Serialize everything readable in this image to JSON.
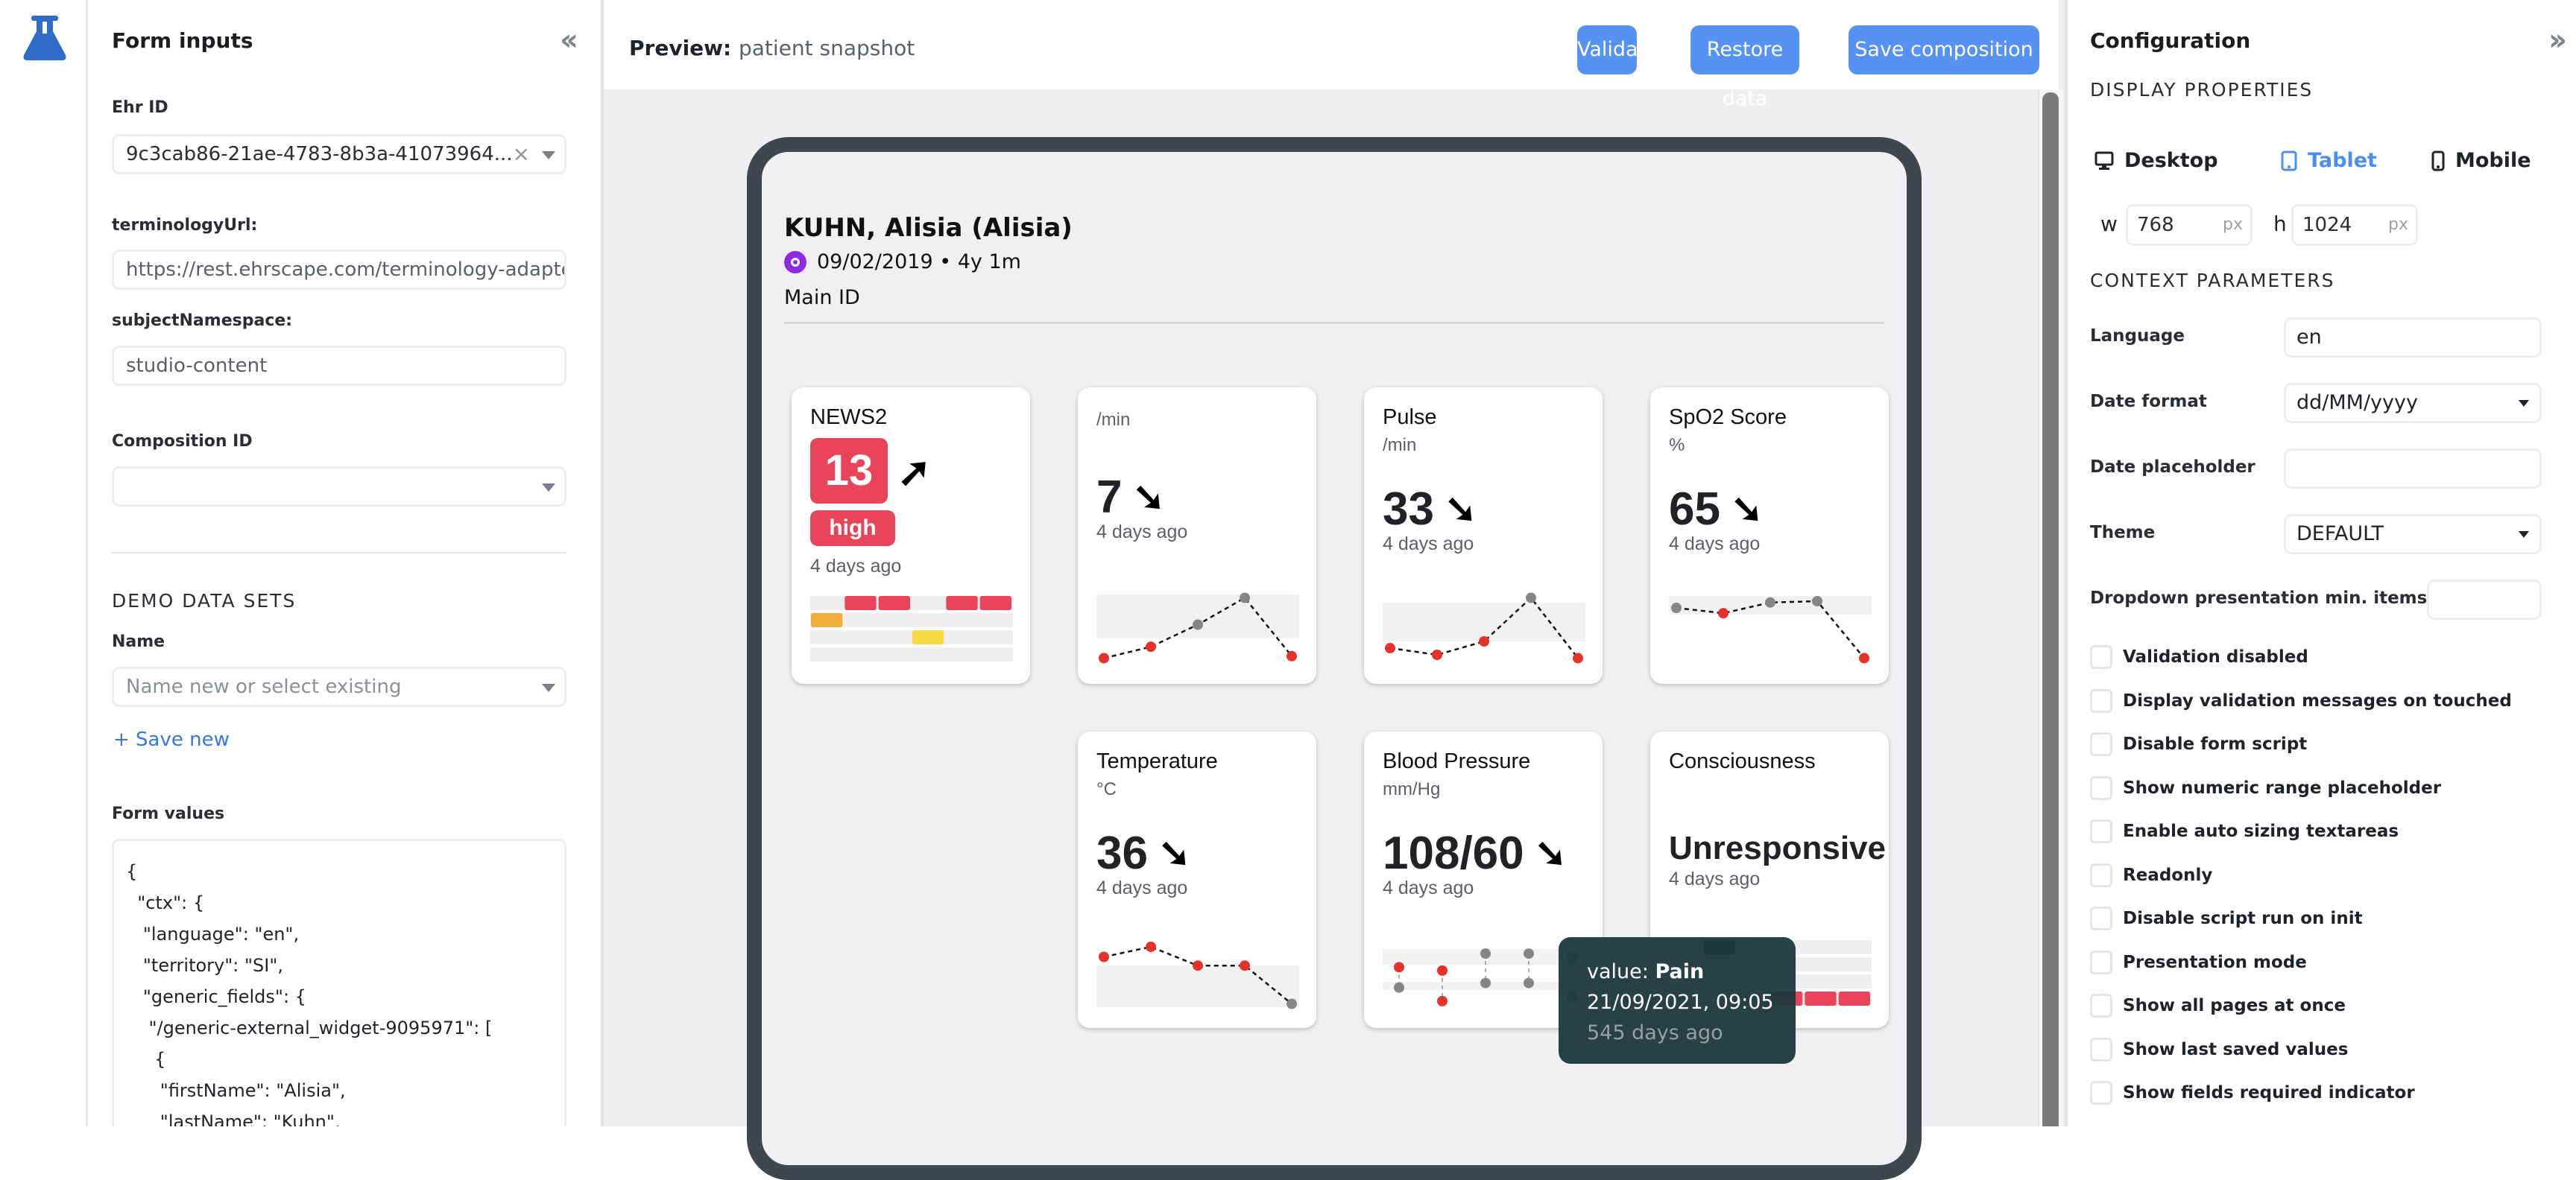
{
  "app": {
    "logo_icon": "flask-icon"
  },
  "left_panel": {
    "title": "Form inputs",
    "collapse_icon": "double-chevron-left-icon",
    "ehr_id": {
      "label": "Ehr ID",
      "value": "9c3cab86-21ae-4783-8b3a-41073964..."
    },
    "terminology_url": {
      "label": "terminologyUrl:",
      "value": "https://rest.ehrscape.com/terminology-adapter"
    },
    "subject_namespace": {
      "label": "subjectNamespace:",
      "value": "studio-content"
    },
    "composition_id": {
      "label": "Composition ID",
      "value": ""
    },
    "demo_section": "DEMO DATA SETS",
    "name": {
      "label": "Name",
      "placeholder": "Name new or select existing"
    },
    "save_new": "+ Save new",
    "form_values_label": "Form values",
    "form_values": "{\n  \"ctx\": {\n   \"language\": \"en\",\n   \"territory\": \"SI\",\n   \"generic_fields\": {\n    \"/generic-external_widget-9095971\": [\n     {\n      \"firstName\": \"Alisia\",\n      \"lastName\": \"Kuhn\","
  },
  "preview": {
    "title_prefix": "Preview:",
    "title_name": "patient snapshot",
    "buttons": {
      "validate": "Validate",
      "restore": "Restore data",
      "save": "Save composition"
    },
    "patient": {
      "name": "KUHN, Alisia (Alisia)",
      "gender_icon": "female-gender-icon",
      "dob": "09/02/2019 • 4y 1m",
      "main_id": "Main ID"
    },
    "cards": [
      {
        "title": "NEWS2",
        "value": "13",
        "trend": "up",
        "trend_glyph": "➚",
        "risk": "high",
        "ago": "4 days ago",
        "grid": {
          "rows": 4,
          "cols": 6,
          "cells": [
            {
              "row": 0,
              "col": 1,
              "color": "#e9445a"
            },
            {
              "row": 0,
              "col": 2,
              "color": "#e9445a"
            },
            {
              "row": 0,
              "col": 4,
              "color": "#e9445a"
            },
            {
              "row": 0,
              "col": 5,
              "color": "#e9445a"
            },
            {
              "row": 1,
              "col": 0,
              "color": "#f2ae3d"
            },
            {
              "row": 2,
              "col": 3,
              "color": "#f7d946"
            }
          ]
        }
      },
      {
        "title": "",
        "unit": "/min",
        "value": "7",
        "trend_glyph": "➘",
        "ago": "4 days ago",
        "spark": {
          "points": [
            {
              "v": 0.05,
              "alert": true
            },
            {
              "v": 0.22,
              "alert": true
            },
            {
              "v": 0.55,
              "alert": false
            },
            {
              "v": 0.95,
              "alert": false
            },
            {
              "v": 0.08,
              "alert": true
            }
          ],
          "band": [
            0.35,
            1.0
          ]
        }
      },
      {
        "title": "Pulse",
        "unit": "/min",
        "value": "33",
        "trend_glyph": "➘",
        "ago": "4 days ago",
        "spark": {
          "points": [
            {
              "v": 0.2,
              "alert": true
            },
            {
              "v": 0.1,
              "alert": true
            },
            {
              "v": 0.3,
              "alert": true
            },
            {
              "v": 0.95,
              "alert": false
            },
            {
              "v": 0.05,
              "alert": true
            }
          ],
          "band": [
            0.3,
            0.88
          ]
        }
      },
      {
        "title": "SpO2 Score",
        "unit": "%",
        "value": "65",
        "trend_glyph": "➘",
        "ago": "4 days ago",
        "spark": {
          "points": [
            {
              "v": 0.8,
              "alert": false
            },
            {
              "v": 0.72,
              "alert": true
            },
            {
              "v": 0.88,
              "alert": false
            },
            {
              "v": 0.9,
              "alert": false
            },
            {
              "v": 0.05,
              "alert": true
            }
          ],
          "band": [
            0.7,
            0.98
          ]
        }
      },
      {
        "title": "Temperature",
        "unit": "°C",
        "value": "36",
        "trend_glyph": "➘",
        "ago": "4 days ago",
        "spark": {
          "points": [
            {
              "v": 0.75,
              "alert": true
            },
            {
              "v": 0.9,
              "alert": true
            },
            {
              "v": 0.62,
              "alert": true
            },
            {
              "v": 0.62,
              "alert": true
            },
            {
              "v": 0.05,
              "alert": false
            }
          ],
          "band": [
            0.0,
            0.62
          ]
        }
      },
      {
        "title": "Blood Pressure",
        "unit": "mm/Hg",
        "value": "108/60",
        "trend_glyph": "➘",
        "ago": "4 days ago",
        "bp": [
          {
            "sys": 0.68,
            "dia": 0.32,
            "alert_sys": true,
            "alert_dia": false
          },
          {
            "sys": 0.62,
            "dia": 0.08,
            "alert_sys": true,
            "alert_dia": true
          },
          {
            "sys": 0.92,
            "dia": 0.4,
            "alert_sys": false,
            "alert_dia": false
          },
          {
            "sys": 0.92,
            "dia": 0.4,
            "alert_sys": false,
            "alert_dia": false
          },
          {
            "sys": 0.85,
            "dia": 0.15,
            "alert_sys": false,
            "alert_dia": false
          }
        ]
      },
      {
        "title": "Consciousness",
        "value": "Unresponsive",
        "ago": "4 days ago",
        "grid": {
          "rows": 4,
          "cols": 6,
          "cells": [
            {
              "row": 0,
              "col": 1,
              "color": "#1f3a40"
            },
            {
              "row": 3,
              "col": 3,
              "color": "#e9445a"
            },
            {
              "row": 3,
              "col": 4,
              "color": "#e9445a"
            },
            {
              "row": 3,
              "col": 5,
              "color": "#e9445a"
            }
          ]
        }
      }
    ],
    "tooltip": {
      "value_label": "value:",
      "value": "Pain",
      "datetime": "21/09/2021, 09:05",
      "ago": "545 days ago"
    }
  },
  "right_panel": {
    "title": "Configuration",
    "expand_icon": "double-chevron-right-icon",
    "display_section": "DISPLAY PROPERTIES",
    "devices": [
      {
        "label": "Desktop",
        "icon": "desktop-icon",
        "active": false
      },
      {
        "label": "Tablet",
        "icon": "tablet-icon",
        "active": true
      },
      {
        "label": "Mobile",
        "icon": "mobile-icon",
        "active": false
      }
    ],
    "width": {
      "label": "w",
      "value": "768",
      "unit": "px"
    },
    "height": {
      "label": "h",
      "value": "1024",
      "unit": "px"
    },
    "context_section": "CONTEXT PARAMETERS",
    "language": {
      "label": "Language",
      "value": "en"
    },
    "date_format": {
      "label": "Date format",
      "value": "dd/MM/yyyy"
    },
    "date_placeholder": {
      "label": "Date placeholder",
      "value": ""
    },
    "theme": {
      "label": "Theme",
      "value": "DEFAULT"
    },
    "dropdown_min": {
      "label": "Dropdown presentation min. items",
      "value": ""
    },
    "checkboxes": [
      {
        "label": "Validation disabled",
        "checked": false
      },
      {
        "label": "Display validation messages on touched",
        "checked": false
      },
      {
        "label": "Disable form script",
        "checked": false
      },
      {
        "label": "Show numeric range placeholder",
        "checked": false
      },
      {
        "label": "Enable auto sizing textareas",
        "checked": false
      },
      {
        "label": "Readonly",
        "checked": false
      },
      {
        "label": "Disable script run on init",
        "checked": false
      },
      {
        "label": "Presentation mode",
        "checked": false
      },
      {
        "label": "Show all pages at once",
        "checked": false
      },
      {
        "label": "Show last saved values",
        "checked": false
      },
      {
        "label": "Show fields required indicator",
        "checked": false
      }
    ]
  },
  "colors": {
    "accent": "#5592f3",
    "alert": "#e9445a",
    "alert_dot": "#e5332a",
    "normal_dot": "#858585",
    "frame": "#3f464e",
    "tooltip": "#1b373d"
  }
}
